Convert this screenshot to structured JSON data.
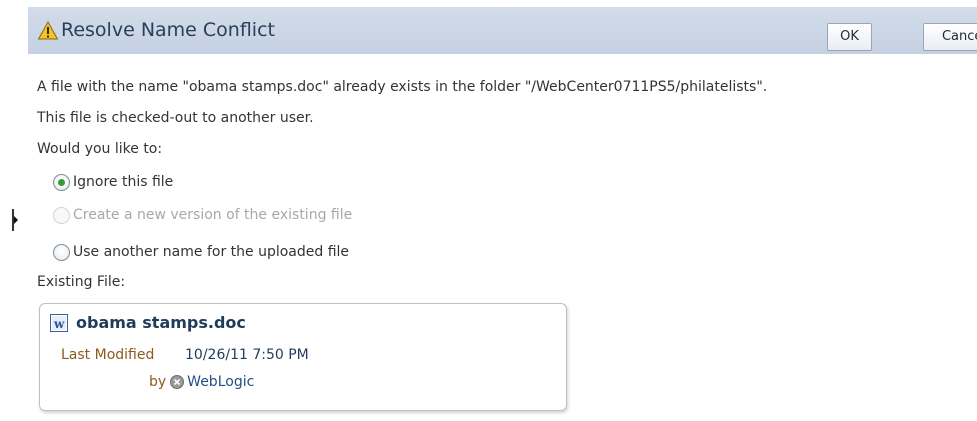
{
  "dialog": {
    "title": "Resolve Name Conflict",
    "ok_label": "OK",
    "cancel_label": "Cancel",
    "message_line1": "A file with the name \"obama stamps.doc\" already exists in the folder \"/WebCenter0711PS5/philatelists\".",
    "message_line2": "This file is checked-out to another user.",
    "prompt": "Would you like to:"
  },
  "options": [
    {
      "label": "Ignore this file",
      "selected": true,
      "enabled": true
    },
    {
      "label": "Create a new version of the existing file",
      "selected": false,
      "enabled": false
    },
    {
      "label": "Use another name for the uploaded file",
      "selected": false,
      "enabled": true
    }
  ],
  "existing_file": {
    "section_label": "Existing File:",
    "name": "obama stamps.doc",
    "last_modified_label": "Last Modified",
    "last_modified_value": "10/26/11 7:50 PM",
    "by_label": "by",
    "user": "WebLogic"
  },
  "icons": {
    "warning": "warning-icon",
    "file_type": "word-document-icon",
    "user": "user-presence-icon",
    "side_toggle": "expand-arrow-icon"
  },
  "colors": {
    "header_bg": "#c9d4e5",
    "title_text": "#2b3f57",
    "radio_selected": "#3a9a33",
    "label_brown": "#8a5b1d",
    "link_blue": "#1f4f86"
  }
}
